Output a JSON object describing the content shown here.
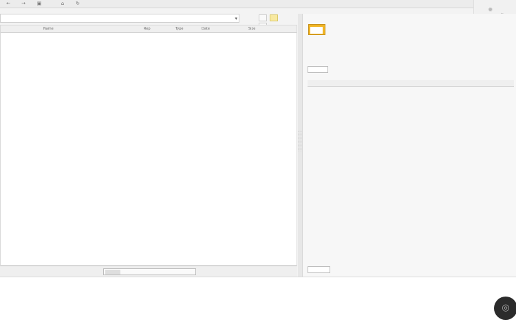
{
  "toolbar": {
    "icons": [
      "arrow-left-icon",
      "arrow-right-icon",
      "copy-icon",
      "lock-icon",
      "refresh-icon"
    ]
  },
  "left_panel": {
    "columns": [
      "Name",
      "Rep",
      "Type",
      "Date",
      "Size"
    ],
    "rows": []
  },
  "right_panel": {
    "tabs": [],
    "search_label": "",
    "columns": [],
    "rows": []
  }
}
